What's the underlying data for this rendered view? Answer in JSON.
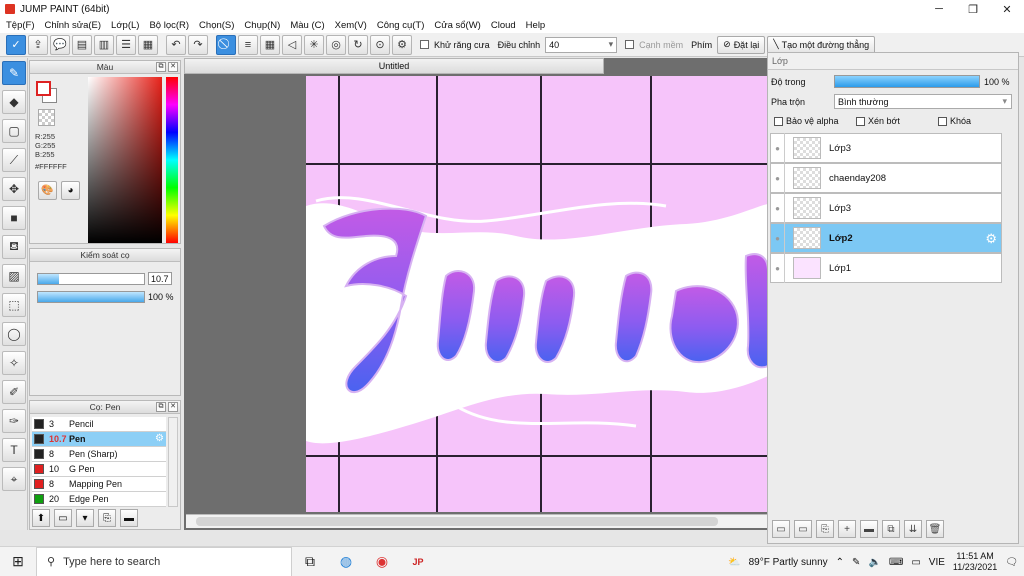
{
  "window": {
    "title": "JUMP PAINT (64bit)",
    "controls": [
      "─",
      "❐",
      "✕"
    ]
  },
  "menu": [
    "Tệp(F)",
    "Chỉnh sửa(E)",
    "Lớp(L)",
    "Bộ lọc(R)",
    "Chọn(S)",
    "Chụp(N)",
    "Màu (C)",
    "Xem(V)",
    "Công cụ(T)",
    "Cửa sổ(W)",
    "Cloud",
    "Help"
  ],
  "toolbar": {
    "antialias_label": "Khử răng cưa",
    "adjust_label": "Điều chỉnh",
    "adjust_value": "40",
    "soft_edge_label": "Cạnh mềm",
    "key_label": "Phím",
    "reset_label": "Đặt lại",
    "line_label": "Tạo một đường thẳng"
  },
  "color_panel": {
    "title": "Màu",
    "r": "R:255",
    "g": "G:255",
    "b": "B:255",
    "hex": "#FFFFFF"
  },
  "brush_control": {
    "title": "Kiểm soát cọ",
    "size_value": "10.7",
    "size_fraction": 0.2,
    "opacity_label": "100 %",
    "opacity_fraction": 1.0
  },
  "brush_list": {
    "title": "Cọ: Pen",
    "items": [
      {
        "size": "3",
        "name": "Pencil",
        "color": "#222222"
      },
      {
        "size": "10.7",
        "name": "Pen",
        "color": "#222222"
      },
      {
        "size": "8",
        "name": "Pen (Sharp)",
        "color": "#222222"
      },
      {
        "size": "10",
        "name": "G Pen",
        "color": "#e02020"
      },
      {
        "size": "8",
        "name": "Mapping Pen",
        "color": "#e02020"
      },
      {
        "size": "20",
        "name": "Edge Pen",
        "color": "#10a010"
      }
    ]
  },
  "document": {
    "tab": "Untitled",
    "canvas_color": "#f6c4fa"
  },
  "layer_panel": {
    "title": "Lớp",
    "opacity_label": "Độ trong",
    "opacity_value": "100 %",
    "opacity_fraction": 1.0,
    "blend_label": "Pha trộn",
    "blend_value": "Bình thường",
    "protect_alpha": "Bảo vệ alpha",
    "clipping": "Xén bớt",
    "lock": "Khóa",
    "layers": [
      {
        "name": "Lớp3"
      },
      {
        "name": "chaenday208"
      },
      {
        "name": "Lớp3"
      },
      {
        "name": "Lớp2"
      },
      {
        "name": "Lớp1"
      }
    ]
  },
  "taskbar": {
    "search_placeholder": "Type here to search",
    "weather": "89°F  Partly sunny",
    "lang": "VIE",
    "time": "11:51 AM",
    "date": "11/23/2021"
  }
}
